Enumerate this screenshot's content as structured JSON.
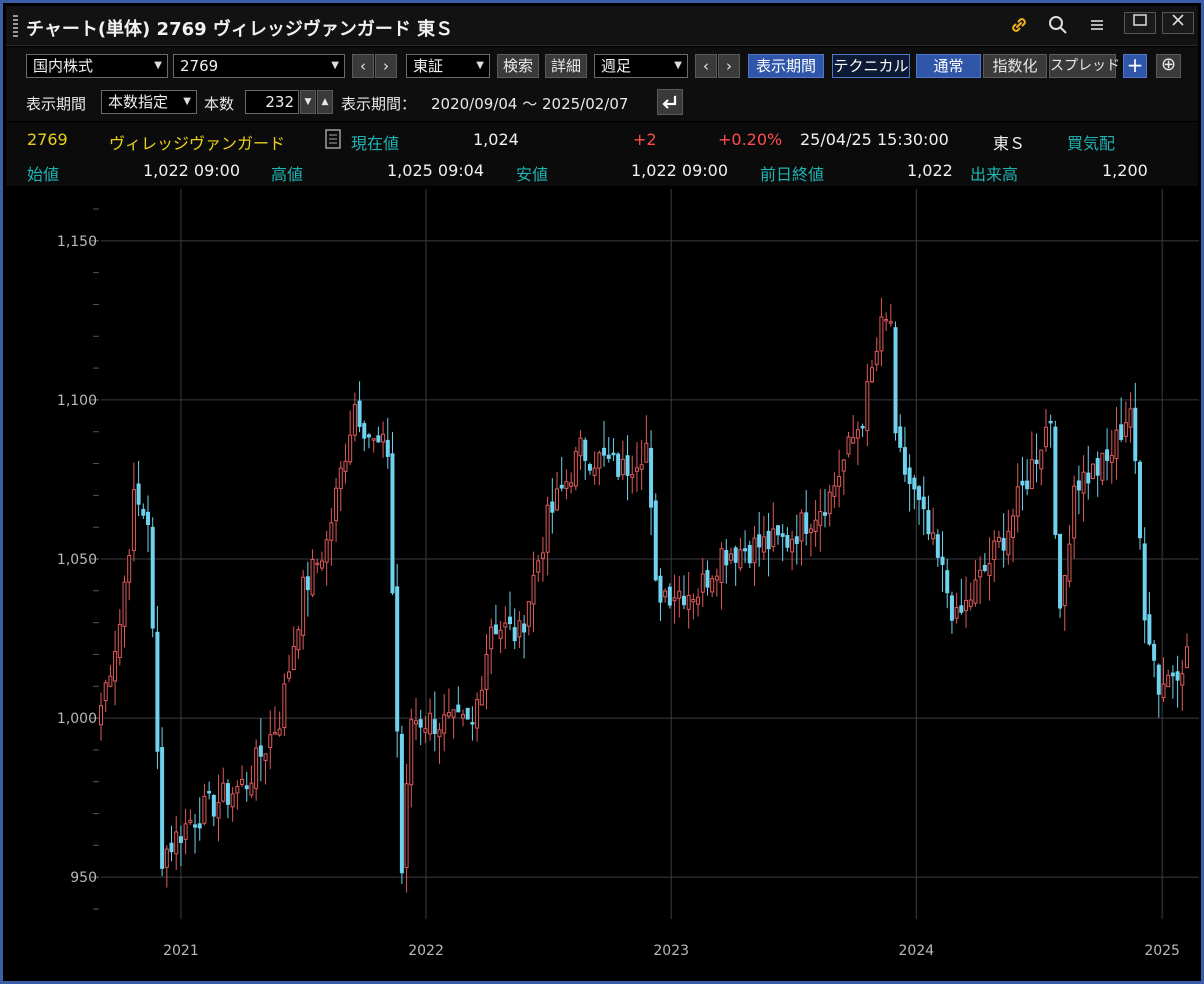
{
  "window": {
    "title": "チャート(単体) 2769 ヴィレッジヴァンガード 東Ｓ",
    "icons": [
      "link-icon",
      "search-icon",
      "menu-icon",
      "maximize-icon",
      "close-icon"
    ]
  },
  "toolbar": {
    "market_select": "国内株式",
    "code_select": "2769",
    "prev_symbol": "‹",
    "next_symbol": "›",
    "exchange_select": "東証",
    "search_button": "検索",
    "detail_button": "詳細",
    "interval_select": "週足",
    "prev_period": "‹",
    "next_period": "›",
    "period_button": "表示期間",
    "technical_button": "テクニカル",
    "normal_button": "通常",
    "index_button": "指数化",
    "spread_button": "スプレッド",
    "add_button": "+",
    "zoom_button": "⊕"
  },
  "period_bar": {
    "period_label": "表示期間",
    "period_mode_select": "本数指定",
    "count_label": "本数",
    "count_value": "232",
    "range_label": "表示期間：",
    "range_value": "2020/09/04 ～ 2025/02/07",
    "reset_icon": "return-icon"
  },
  "quote": {
    "code": "2769",
    "name": "ヴィレッジヴァンガード",
    "current_label": "現在値",
    "current_value": "1,024",
    "change": "+2",
    "change_pct": "+0.20%",
    "datetime": "25/04/25  15:30:00",
    "market": "東Ｓ",
    "status": "買気配",
    "open_label": "始値",
    "open_value": "1,022  09:00",
    "high_label": "高値",
    "high_value": "1,025  09:04",
    "low_label": "安値",
    "low_value": "1,022  09:00",
    "prev_close_label": "前日終値",
    "prev_close_value": "1,022",
    "volume_label": "出来高",
    "volume_value": "1,200"
  },
  "colors": {
    "up": "#e05a5a",
    "down": "#6fd3ef",
    "accent": "#2f56a8",
    "quote_label": "#1fb3b3",
    "quote_name": "#e8d21d",
    "change": "#ff4c4c"
  },
  "chart_data": {
    "type": "candlestick",
    "y_ticks": [
      "950",
      "1,000",
      "1,050",
      "1,100",
      "1,150"
    ],
    "x_ticks": [
      "2021",
      "2022",
      "2023",
      "2024",
      "2025"
    ],
    "ylim": [
      940,
      1160
    ],
    "grid": true,
    "interval": "weekly",
    "bars": 232,
    "waypoints": [
      {
        "date": "2020-09-04",
        "close": 1004
      },
      {
        "date": "2020-10-02",
        "close": 1030
      },
      {
        "date": "2020-10-23",
        "close": 1068
      },
      {
        "date": "2020-11-13",
        "close": 1063
      },
      {
        "date": "2020-11-27",
        "close": 988
      },
      {
        "date": "2020-12-04",
        "close": 957
      },
      {
        "date": "2021-01-15",
        "close": 968
      },
      {
        "date": "2021-04-09",
        "close": 980
      },
      {
        "date": "2021-05-28",
        "close": 1000
      },
      {
        "date": "2021-07-02",
        "close": 1040
      },
      {
        "date": "2021-08-06",
        "close": 1055
      },
      {
        "date": "2021-09-17",
        "close": 1099
      },
      {
        "date": "2021-10-15",
        "close": 1086
      },
      {
        "date": "2021-11-05",
        "close": 1084
      },
      {
        "date": "2021-11-26",
        "close": 952
      },
      {
        "date": "2021-12-10",
        "close": 1000
      },
      {
        "date": "2022-03-11",
        "close": 997
      },
      {
        "date": "2022-04-08",
        "close": 1030
      },
      {
        "date": "2022-05-20",
        "close": 1026
      },
      {
        "date": "2022-07-01",
        "close": 1062
      },
      {
        "date": "2022-08-19",
        "close": 1084
      },
      {
        "date": "2022-10-21",
        "close": 1078
      },
      {
        "date": "2022-11-25",
        "close": 1086
      },
      {
        "date": "2022-12-09",
        "close": 1040
      },
      {
        "date": "2023-02-10",
        "close": 1040
      },
      {
        "date": "2023-03-17",
        "close": 1052
      },
      {
        "date": "2023-06-23",
        "close": 1056
      },
      {
        "date": "2023-08-25",
        "close": 1070
      },
      {
        "date": "2023-10-13",
        "close": 1095
      },
      {
        "date": "2023-11-10",
        "close": 1122
      },
      {
        "date": "2023-11-24",
        "close": 1125
      },
      {
        "date": "2023-12-01",
        "close": 1085
      },
      {
        "date": "2023-12-29",
        "close": 1070
      },
      {
        "date": "2024-02-09",
        "close": 1045
      },
      {
        "date": "2024-03-01",
        "close": 1030
      },
      {
        "date": "2024-05-17",
        "close": 1060
      },
      {
        "date": "2024-07-19",
        "close": 1095
      },
      {
        "date": "2024-08-02",
        "close": 1030
      },
      {
        "date": "2024-08-23",
        "close": 1074
      },
      {
        "date": "2024-10-11",
        "close": 1080
      },
      {
        "date": "2024-11-15",
        "close": 1098
      },
      {
        "date": "2024-12-06",
        "close": 1035
      },
      {
        "date": "2024-12-27",
        "close": 1010
      },
      {
        "date": "2025-02-07",
        "close": 1020
      }
    ]
  }
}
